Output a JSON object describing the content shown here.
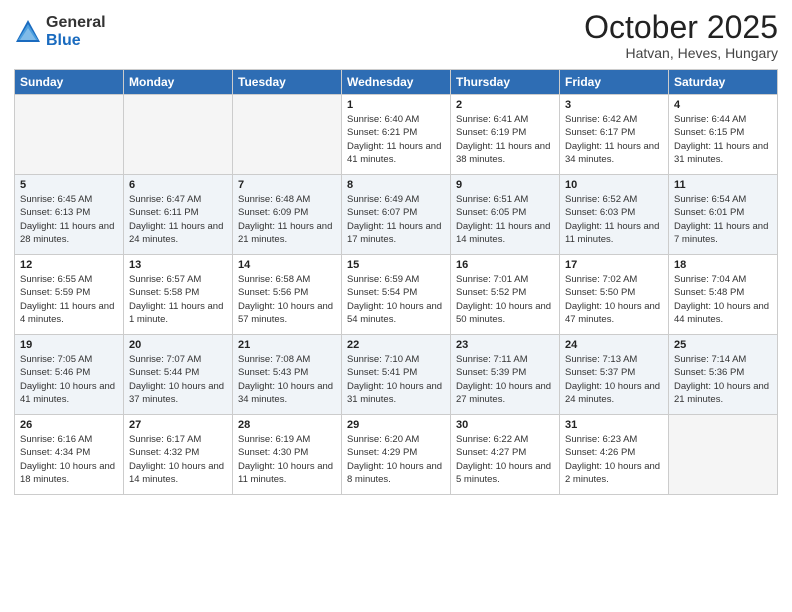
{
  "logo": {
    "general": "General",
    "blue": "Blue"
  },
  "title": "October 2025",
  "location": "Hatvan, Heves, Hungary",
  "days_of_week": [
    "Sunday",
    "Monday",
    "Tuesday",
    "Wednesday",
    "Thursday",
    "Friday",
    "Saturday"
  ],
  "weeks": [
    [
      {
        "day": "",
        "info": ""
      },
      {
        "day": "",
        "info": ""
      },
      {
        "day": "",
        "info": ""
      },
      {
        "day": "1",
        "info": "Sunrise: 6:40 AM\nSunset: 6:21 PM\nDaylight: 11 hours and 41 minutes."
      },
      {
        "day": "2",
        "info": "Sunrise: 6:41 AM\nSunset: 6:19 PM\nDaylight: 11 hours and 38 minutes."
      },
      {
        "day": "3",
        "info": "Sunrise: 6:42 AM\nSunset: 6:17 PM\nDaylight: 11 hours and 34 minutes."
      },
      {
        "day": "4",
        "info": "Sunrise: 6:44 AM\nSunset: 6:15 PM\nDaylight: 11 hours and 31 minutes."
      }
    ],
    [
      {
        "day": "5",
        "info": "Sunrise: 6:45 AM\nSunset: 6:13 PM\nDaylight: 11 hours and 28 minutes."
      },
      {
        "day": "6",
        "info": "Sunrise: 6:47 AM\nSunset: 6:11 PM\nDaylight: 11 hours and 24 minutes."
      },
      {
        "day": "7",
        "info": "Sunrise: 6:48 AM\nSunset: 6:09 PM\nDaylight: 11 hours and 21 minutes."
      },
      {
        "day": "8",
        "info": "Sunrise: 6:49 AM\nSunset: 6:07 PM\nDaylight: 11 hours and 17 minutes."
      },
      {
        "day": "9",
        "info": "Sunrise: 6:51 AM\nSunset: 6:05 PM\nDaylight: 11 hours and 14 minutes."
      },
      {
        "day": "10",
        "info": "Sunrise: 6:52 AM\nSunset: 6:03 PM\nDaylight: 11 hours and 11 minutes."
      },
      {
        "day": "11",
        "info": "Sunrise: 6:54 AM\nSunset: 6:01 PM\nDaylight: 11 hours and 7 minutes."
      }
    ],
    [
      {
        "day": "12",
        "info": "Sunrise: 6:55 AM\nSunset: 5:59 PM\nDaylight: 11 hours and 4 minutes."
      },
      {
        "day": "13",
        "info": "Sunrise: 6:57 AM\nSunset: 5:58 PM\nDaylight: 11 hours and 1 minute."
      },
      {
        "day": "14",
        "info": "Sunrise: 6:58 AM\nSunset: 5:56 PM\nDaylight: 10 hours and 57 minutes."
      },
      {
        "day": "15",
        "info": "Sunrise: 6:59 AM\nSunset: 5:54 PM\nDaylight: 10 hours and 54 minutes."
      },
      {
        "day": "16",
        "info": "Sunrise: 7:01 AM\nSunset: 5:52 PM\nDaylight: 10 hours and 50 minutes."
      },
      {
        "day": "17",
        "info": "Sunrise: 7:02 AM\nSunset: 5:50 PM\nDaylight: 10 hours and 47 minutes."
      },
      {
        "day": "18",
        "info": "Sunrise: 7:04 AM\nSunset: 5:48 PM\nDaylight: 10 hours and 44 minutes."
      }
    ],
    [
      {
        "day": "19",
        "info": "Sunrise: 7:05 AM\nSunset: 5:46 PM\nDaylight: 10 hours and 41 minutes."
      },
      {
        "day": "20",
        "info": "Sunrise: 7:07 AM\nSunset: 5:44 PM\nDaylight: 10 hours and 37 minutes."
      },
      {
        "day": "21",
        "info": "Sunrise: 7:08 AM\nSunset: 5:43 PM\nDaylight: 10 hours and 34 minutes."
      },
      {
        "day": "22",
        "info": "Sunrise: 7:10 AM\nSunset: 5:41 PM\nDaylight: 10 hours and 31 minutes."
      },
      {
        "day": "23",
        "info": "Sunrise: 7:11 AM\nSunset: 5:39 PM\nDaylight: 10 hours and 27 minutes."
      },
      {
        "day": "24",
        "info": "Sunrise: 7:13 AM\nSunset: 5:37 PM\nDaylight: 10 hours and 24 minutes."
      },
      {
        "day": "25",
        "info": "Sunrise: 7:14 AM\nSunset: 5:36 PM\nDaylight: 10 hours and 21 minutes."
      }
    ],
    [
      {
        "day": "26",
        "info": "Sunrise: 6:16 AM\nSunset: 4:34 PM\nDaylight: 10 hours and 18 minutes."
      },
      {
        "day": "27",
        "info": "Sunrise: 6:17 AM\nSunset: 4:32 PM\nDaylight: 10 hours and 14 minutes."
      },
      {
        "day": "28",
        "info": "Sunrise: 6:19 AM\nSunset: 4:30 PM\nDaylight: 10 hours and 11 minutes."
      },
      {
        "day": "29",
        "info": "Sunrise: 6:20 AM\nSunset: 4:29 PM\nDaylight: 10 hours and 8 minutes."
      },
      {
        "day": "30",
        "info": "Sunrise: 6:22 AM\nSunset: 4:27 PM\nDaylight: 10 hours and 5 minutes."
      },
      {
        "day": "31",
        "info": "Sunrise: 6:23 AM\nSunset: 4:26 PM\nDaylight: 10 hours and 2 minutes."
      },
      {
        "day": "",
        "info": ""
      }
    ]
  ]
}
